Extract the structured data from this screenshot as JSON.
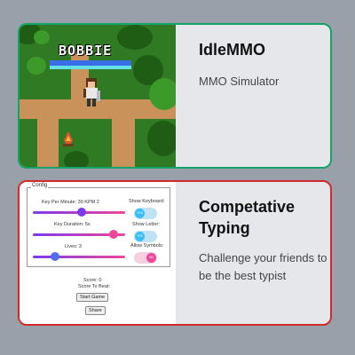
{
  "cards": [
    {
      "title": "IdleMMO",
      "description": "MMO Simulator",
      "border_color": "#16a36a",
      "thumbnail": {
        "player_name": "BOBBIE",
        "icons": [
          "bush-icon",
          "player-character-icon",
          "campfire-icon"
        ]
      }
    },
    {
      "title": "Competative Typing",
      "description": "Challenge your friends to be the best typist",
      "border_color": "#d02a2a",
      "thumbnail": {
        "config_legend": "Config",
        "key_per_minute_label": "Key Per Minute: 30 KPM 2",
        "key_duration_label": "Key Duration: 5s",
        "lives_label": "Lives: 3",
        "show_keyboard_label": "Show Keyboard:",
        "show_letter_label": "Show Letter:",
        "allow_symbols_label": "Allow Symbols:",
        "toggle_yes": "YES",
        "toggle_no": "NO",
        "score_label": "Score: 0",
        "score_to_beat_label": "Score To Beat:",
        "start_button": "Start Game",
        "share_button": "Share"
      }
    }
  ],
  "colors": {
    "background": "#9aa0aa",
    "card_background": "#e5e7eb",
    "slider_purple": "#7c3aed",
    "slider_pink": "#ec4899",
    "toggle_blue": "#38bdf8"
  }
}
